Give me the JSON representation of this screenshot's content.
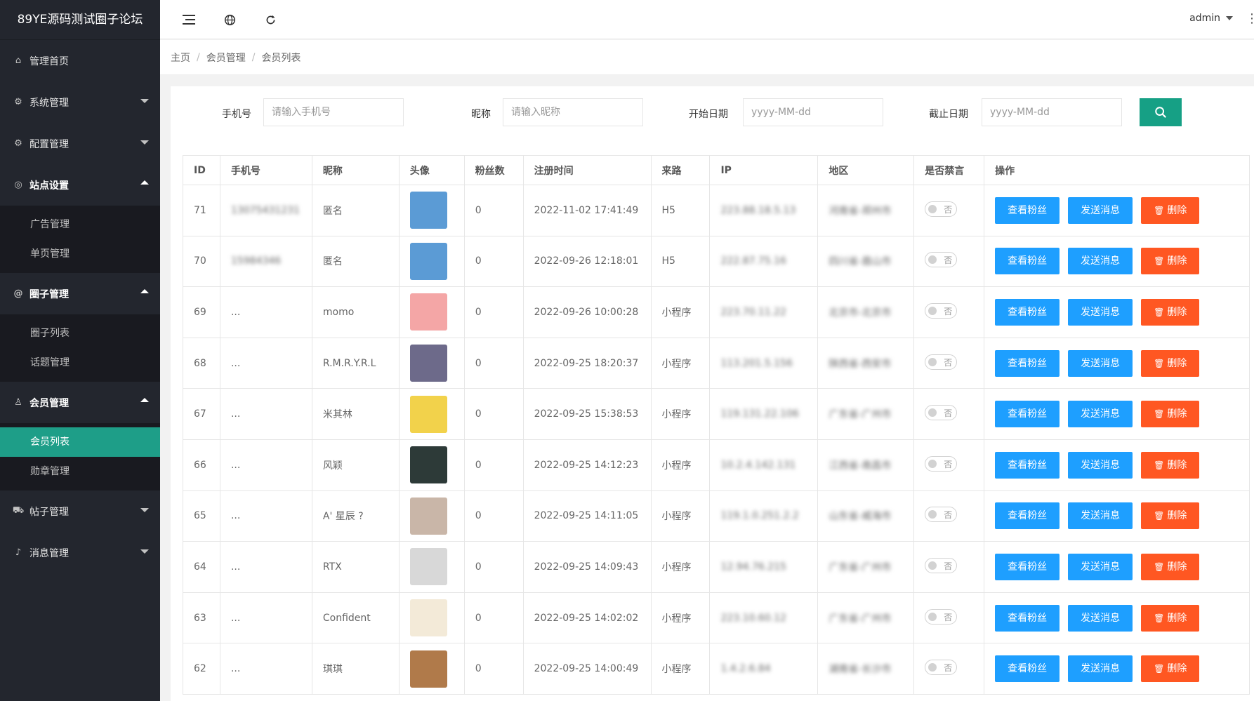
{
  "brand": "89YE源码测试圈子论坛",
  "sidebar": {
    "items": [
      {
        "label": "管理首页",
        "icon": "home-icon",
        "arrow": ""
      },
      {
        "label": "系统管理",
        "icon": "gear-icon",
        "arrow": "down"
      },
      {
        "label": "配置管理",
        "icon": "gear-icon",
        "arrow": "down"
      },
      {
        "label": "站点设置",
        "icon": "palette-icon",
        "arrow": "up"
      },
      {
        "label": "圈子管理",
        "icon": "at-icon",
        "arrow": "up"
      },
      {
        "label": "会员管理",
        "icon": "user-icon",
        "arrow": "up"
      },
      {
        "label": "帖子管理",
        "icon": "cart-icon",
        "arrow": "down"
      },
      {
        "label": "消息管理",
        "icon": "speaker-icon",
        "arrow": "down"
      }
    ],
    "site_sub": [
      "广告管理",
      "单页管理"
    ],
    "circle_sub": [
      "圈子列表",
      "话题管理"
    ],
    "member_sub": [
      "会员列表",
      "勋章管理"
    ]
  },
  "header": {
    "user": "admin"
  },
  "breadcrumb": {
    "home": "主页",
    "section": "会员管理",
    "current": "会员列表",
    "separator": "/"
  },
  "search": {
    "phone_label": "手机号",
    "phone_placeholder": "请输入手机号",
    "nick_label": "昵称",
    "nick_placeholder": "请输入昵称",
    "start_label": "开始日期",
    "start_placeholder": "yyyy-MM-dd",
    "end_label": "截止日期",
    "end_placeholder": "yyyy-MM-dd"
  },
  "table": {
    "headers": [
      "ID",
      "手机号",
      "昵称",
      "头像",
      "粉丝数",
      "注册时间",
      "来路",
      "IP",
      "地区",
      "是否禁言",
      "操作"
    ],
    "rows": [
      {
        "id": "71",
        "phone": "13075431231",
        "nick": "匿名",
        "avatar": "#5b9bd5",
        "fans": "0",
        "time": "2022-11-02 17:41:49",
        "src": "H5",
        "ip": "223.88.18.5.13",
        "region": "河南省-郑州市",
        "mute": "否"
      },
      {
        "id": "70",
        "phone": "15984346",
        "nick": "匿名",
        "avatar": "#5b9bd5",
        "fans": "0",
        "time": "2022-09-26 12:18:01",
        "src": "H5",
        "ip": "222.87.75.16",
        "region": "四川省-眉山市",
        "mute": "否"
      },
      {
        "id": "69",
        "phone": "...",
        "nick": "momo",
        "avatar": "#f4a6a6",
        "fans": "0",
        "time": "2022-09-26 10:00:28",
        "src": "小程序",
        "ip": "223.70.11.22",
        "region": "北京市-北京市",
        "mute": "否"
      },
      {
        "id": "68",
        "phone": "...",
        "nick": "R.M.R.Y.R.L",
        "avatar": "#6d6a8a",
        "fans": "0",
        "time": "2022-09-25 18:20:37",
        "src": "小程序",
        "ip": "113.201.5.156",
        "region": "陕西省-西安市",
        "mute": "否"
      },
      {
        "id": "67",
        "phone": "...",
        "nick": "米其林",
        "avatar": "#f2d24b",
        "fans": "0",
        "time": "2022-09-25 15:38:53",
        "src": "小程序",
        "ip": "119.131.22.106",
        "region": "广东省-广州市",
        "mute": "否"
      },
      {
        "id": "66",
        "phone": "...",
        "nick": "风颖",
        "avatar": "#2d3a38",
        "fans": "0",
        "time": "2022-09-25 14:12:23",
        "src": "小程序",
        "ip": "10.2.4.142.131",
        "region": "江西省-南昌市",
        "mute": "否"
      },
      {
        "id": "65",
        "phone": "...",
        "nick": "A' 星辰 ?",
        "avatar": "#c9b6a8",
        "fans": "0",
        "time": "2022-09-25 14:11:05",
        "src": "小程序",
        "ip": "119.1.0.251.2.2",
        "region": "山东省-威海市",
        "mute": "否"
      },
      {
        "id": "64",
        "phone": "...",
        "nick": "RTX",
        "avatar": "#d8d8d8",
        "fans": "0",
        "time": "2022-09-25 14:09:43",
        "src": "小程序",
        "ip": "12.94.76.215",
        "region": "广东省-广州市",
        "mute": "否"
      },
      {
        "id": "63",
        "phone": "...",
        "nick": "Confident",
        "avatar": "#f3ead8",
        "fans": "0",
        "time": "2022-09-25 14:02:02",
        "src": "小程序",
        "ip": "223.10.60.12",
        "region": "广东省-广州市",
        "mute": "否"
      },
      {
        "id": "62",
        "phone": "...",
        "nick": "琪琪",
        "avatar": "#b07a4a",
        "fans": "0",
        "time": "2022-09-25 14:00:49",
        "src": "小程序",
        "ip": "1.4.2.6.84",
        "region": "湖南省-长沙市",
        "mute": "否"
      }
    ],
    "actions": {
      "fans": "查看粉丝",
      "message": "发送消息",
      "delete": "删除"
    }
  },
  "colors": {
    "sidebar_bg": "#23262e",
    "active": "#1e9e88",
    "blue": "#1e9fff",
    "red": "#ff5722",
    "search": "#16a085"
  }
}
